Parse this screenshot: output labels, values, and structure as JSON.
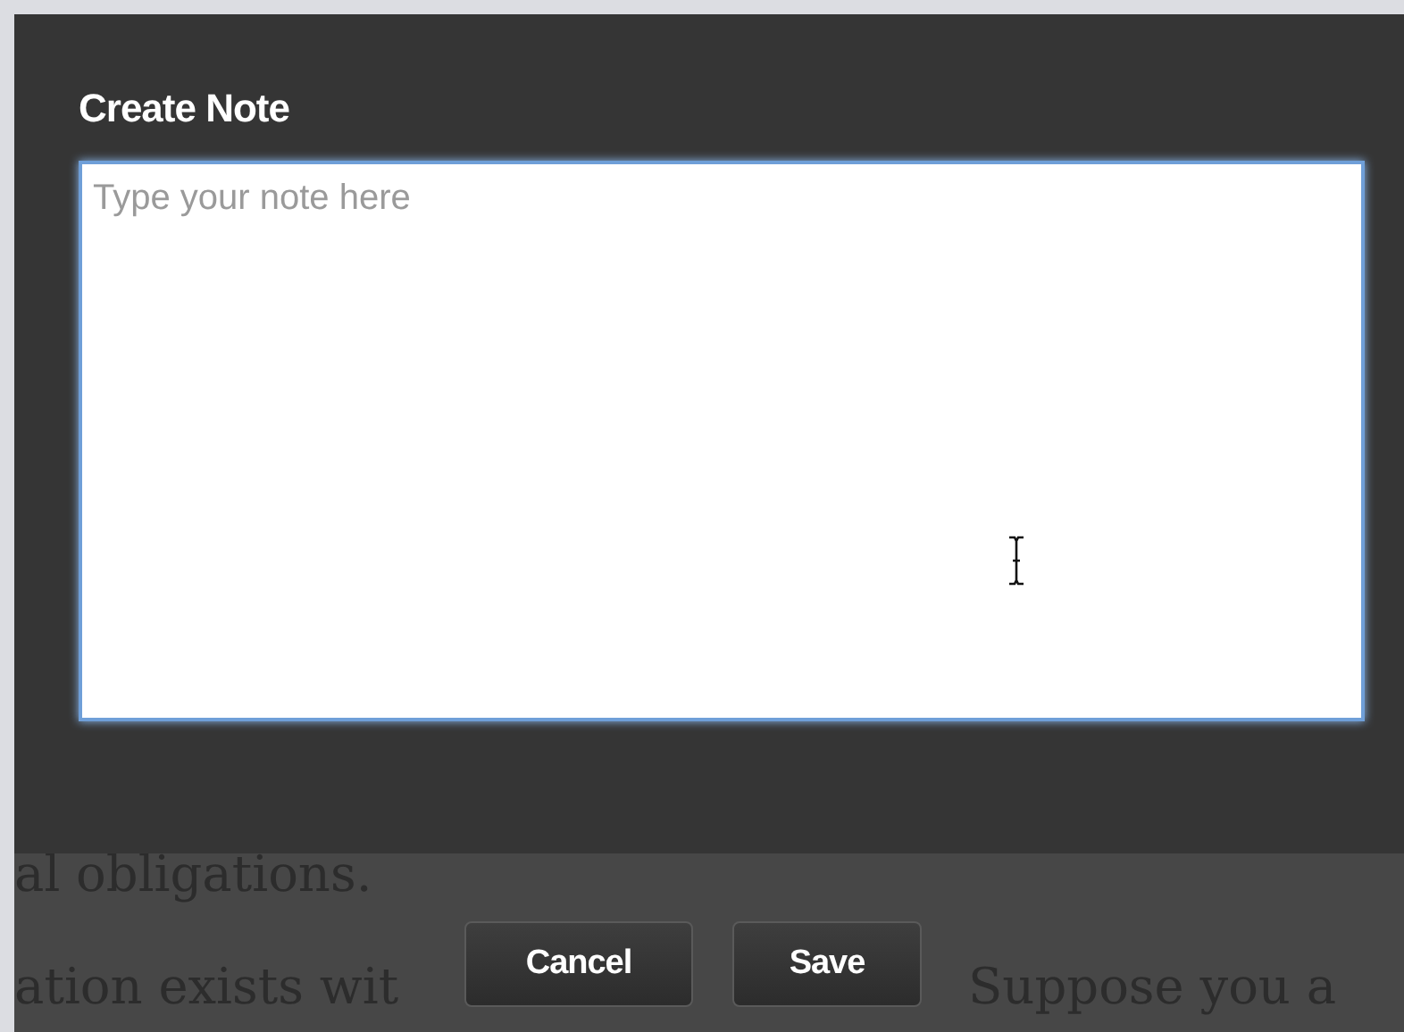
{
  "dialog": {
    "title": "Create Note",
    "note_field": {
      "placeholder": "Type your note here"
    },
    "buttons": [
      {
        "label": "Cancel"
      },
      {
        "label": "Save"
      }
    ]
  },
  "background_text": {
    "line_1": "al obligations.",
    "line_2_left": "ation exists wit",
    "line_2_right": "Suppose you a"
  }
}
